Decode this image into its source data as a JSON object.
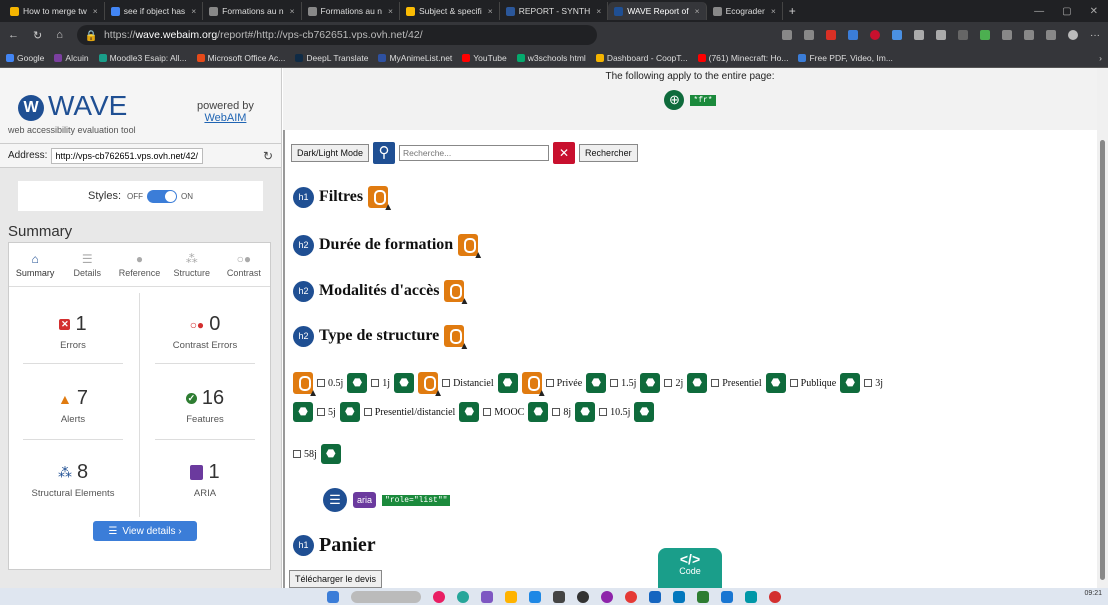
{
  "browser": {
    "tabs": [
      {
        "label": "How to merge tw",
        "color": "#f4b400",
        "active": false
      },
      {
        "label": "see if object has",
        "color": "#4285f4",
        "active": false
      },
      {
        "label": "Formations au n",
        "color": "#888888",
        "active": false
      },
      {
        "label": "Formations au n",
        "color": "#888888",
        "active": false
      },
      {
        "label": "Subject & specifi",
        "color": "#fbbc04",
        "active": false
      },
      {
        "label": "REPORT - SYNTH",
        "color": "#2b579a",
        "active": false
      },
      {
        "label": "WAVE Report of",
        "color": "#1f4f93",
        "active": true
      },
      {
        "label": "Ecograder",
        "color": "#888888",
        "active": false
      }
    ],
    "url_prefix": "https://",
    "url_host": "wave.webaim.org",
    "url_path": "/report#/http://vps-cb762651.vps.ovh.net/42/",
    "bookmarks": [
      {
        "label": "Google",
        "color": "#4285f4"
      },
      {
        "label": "Alcuin",
        "color": "#7b3fa0"
      },
      {
        "label": "Moodle3 Esaip: All...",
        "color": "#1a9e8a"
      },
      {
        "label": "Microsoft Office Ac...",
        "color": "#e64a19"
      },
      {
        "label": "DeepL Translate",
        "color": "#0f2b46"
      },
      {
        "label": "MyAnimeList.net",
        "color": "#2e51a2"
      },
      {
        "label": "YouTube",
        "color": "#ff0000"
      },
      {
        "label": "w3schools html",
        "color": "#04aa6d"
      },
      {
        "label": "Dashboard - CoopT...",
        "color": "#f4b400"
      },
      {
        "label": "(761) Minecraft: Ho...",
        "color": "#ff0000"
      },
      {
        "label": "Free PDF, Video, Im...",
        "color": "#3b7dd8"
      }
    ]
  },
  "wave": {
    "logo": "WAVE",
    "subtitle": "web accessibility evaluation tool",
    "powered_by": "powered by",
    "webaim": "WebAIM",
    "address_label": "Address:",
    "address_value": "http://vps-cb762651.vps.ovh.net/42/",
    "styles_label": "Styles:",
    "styles_off": "OFF",
    "styles_on": "ON",
    "summary_title": "Summary",
    "tabs": [
      "Summary",
      "Details",
      "Reference",
      "Structure",
      "Contrast"
    ],
    "stats": {
      "errors": {
        "value": "1",
        "label": "Errors"
      },
      "contrast": {
        "value": "0",
        "label": "Contrast Errors"
      },
      "alerts": {
        "value": "7",
        "label": "Alerts"
      },
      "features": {
        "value": "16",
        "label": "Features"
      },
      "structural": {
        "value": "8",
        "label": "Structural Elements"
      },
      "aria": {
        "value": "1",
        "label": "ARIA"
      }
    },
    "view_details": "View details ›"
  },
  "page": {
    "note": "The following apply to the entire page:",
    "lang_badge": "*fr*",
    "dark_light": "Dark/Light Mode",
    "search_placeholder": "Recherche...",
    "search_button": "Rechercher",
    "headings": [
      {
        "level": "h1",
        "text": "Filtres"
      },
      {
        "level": "h2",
        "text": "Durée de formation"
      },
      {
        "level": "h2",
        "text": "Modalités d'accès"
      },
      {
        "level": "h2",
        "text": "Type de structure"
      }
    ],
    "checkboxes_row1": [
      "0.5j",
      "1j",
      "Distanciel",
      "Privée",
      "1.5j",
      "2j",
      "Presentiel",
      "Publique",
      "3j"
    ],
    "checkboxes_row2": [
      "5j",
      "Presentiel/distanciel",
      "MOOC",
      "8j",
      "10.5j"
    ],
    "checkboxes_row3": [
      "58j"
    ],
    "aria_label": "aria",
    "aria_role": "\"role=\"list\"\"",
    "panier_level": "h1",
    "panier": "Panier",
    "devis_button": "Télécharger le devis",
    "code_label": "Code",
    "code_glyph": "</>"
  },
  "taskbar": {
    "clock": "09:21"
  }
}
